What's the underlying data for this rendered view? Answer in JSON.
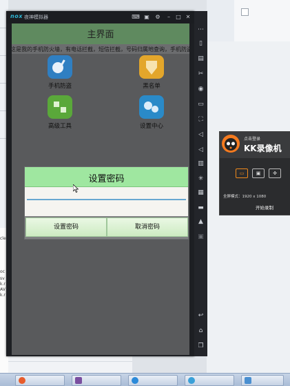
{
  "emulator": {
    "logo": "nox",
    "title": "夜神模拟器",
    "window_buttons": [
      "keyboard",
      "screen",
      "settings",
      "minimize",
      "maximize",
      "close"
    ]
  },
  "app": {
    "title": "主界面",
    "marquee": "这是我的手机防火墙，有电话拦截，短信拦截，号码归属地查询，手机防盗",
    "grid": [
      {
        "label": "手机防盗",
        "icon": "phone-theft-icon",
        "color": "#2f7fc2"
      },
      {
        "label": "黑名单",
        "icon": "blacklist-icon",
        "color": "#e3a62b"
      },
      {
        "label": "高级工具",
        "icon": "advanced-tools-icon",
        "color": "#5aa83a"
      },
      {
        "label": "设置中心",
        "icon": "settings-center-icon",
        "color": "#2a8ac8"
      }
    ]
  },
  "dialog": {
    "title": "设置密码",
    "password_value": "",
    "confirm_label": "设置密码",
    "cancel_label": "取消密码"
  },
  "kk": {
    "login": "点击登录",
    "name": "KK录像机",
    "mode": "全屏模式：1920 x 1080",
    "start": "开始录制"
  },
  "bg_text": [
    "cle",
    "oc",
    "sv",
    "k.r",
    "AV",
    "k.r"
  ],
  "colors": {
    "dialog_header": "#9fe7a0",
    "input_underline": "#67a7d1",
    "emulator_frame": "#1d1f23"
  }
}
